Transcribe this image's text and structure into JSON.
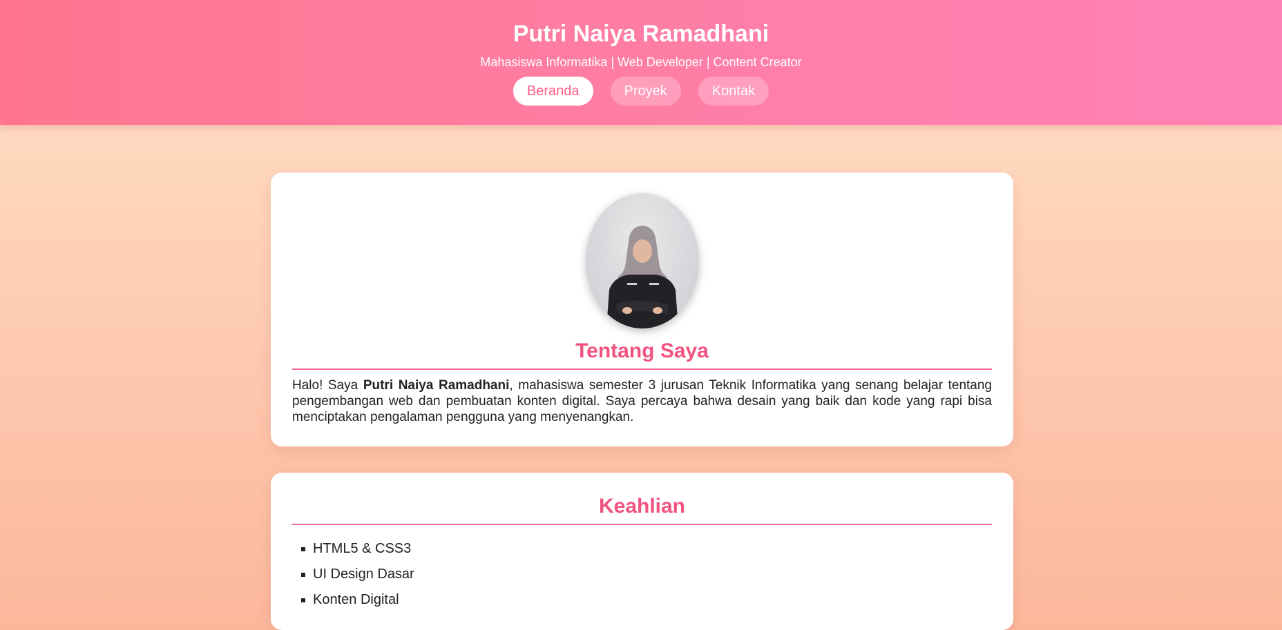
{
  "header": {
    "name": "Putri Naiya Ramadhani",
    "subtitle": "Mahasiswa Informatika | Web Developer | Content Creator",
    "nav": [
      {
        "label": "Beranda",
        "active": true
      },
      {
        "label": "Proyek",
        "active": false
      },
      {
        "label": "Kontak",
        "active": false
      }
    ]
  },
  "about": {
    "title": "Tentang Saya",
    "text_before": "Halo! Saya ",
    "text_bold": "Putri Naiya Ramadhani",
    "text_after": ", mahasiswa semester 3 jurusan Teknik Informatika yang senang belajar tentang pengembangan web dan pembuatan konten digital. Saya percaya bahwa desain yang baik dan kode yang rapi bisa menciptakan pengalaman pengguna yang menyenangkan."
  },
  "skills": {
    "title": "Keahlian",
    "items": [
      "HTML5 & CSS3",
      "UI Design Dasar",
      "Konten Digital"
    ]
  },
  "colors": {
    "accent": "#f0537f",
    "header_start": "#ff758f",
    "header_end": "#ff80b5",
    "background_top": "#ffe3c8",
    "background_bottom": "#fbb79c"
  }
}
